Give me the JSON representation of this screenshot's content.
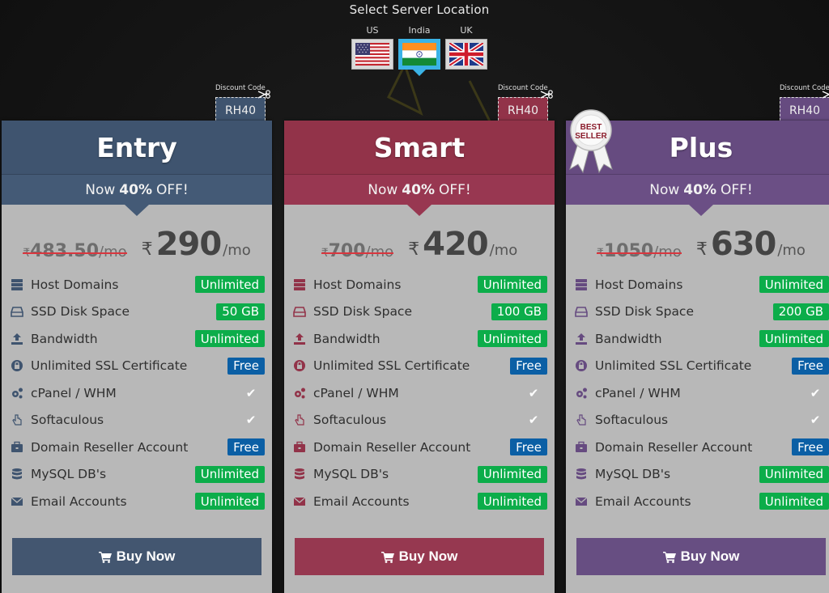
{
  "location_selector": {
    "title": "Select Server Location",
    "options": [
      {
        "label": "US",
        "flag": "us-flag",
        "active": false
      },
      {
        "label": "India",
        "flag": "india-flag",
        "active": true
      },
      {
        "label": "UK",
        "flag": "uk-flag",
        "active": false
      }
    ],
    "active_color": "#3bb3e6"
  },
  "discount": {
    "label": "Discount Code",
    "code": "RH40"
  },
  "best_seller_badge": {
    "line1": "BEST",
    "line2": "SELLER"
  },
  "currency_symbol": "₹",
  "per_period": "/mo",
  "plans": [
    {
      "name": "Entry",
      "offer_prefix": "Now",
      "offer_value": "40%",
      "offer_suffix": "OFF!",
      "old_price": "483.50",
      "new_price": "290",
      "color": "#3f546f",
      "buy_label": "Buy Now",
      "features": [
        {
          "icon": "server-icon",
          "name": "Host Domains",
          "value": "Unlimited",
          "type": "green"
        },
        {
          "icon": "hdd-icon",
          "name": "SSD Disk Space",
          "value": "50 GB",
          "type": "green"
        },
        {
          "icon": "upload-icon",
          "name": "Bandwidth",
          "value": "Unlimited",
          "type": "green"
        },
        {
          "icon": "lock-icon",
          "name": "Unlimited SSL Certificate",
          "value": "Free",
          "type": "blue"
        },
        {
          "icon": "gears-icon",
          "name": "cPanel / WHM",
          "value": "✔",
          "type": "check"
        },
        {
          "icon": "hand-pointer-icon",
          "name": "Softaculous",
          "value": "✔",
          "type": "check"
        },
        {
          "icon": "briefcase-icon",
          "name": "Domain Reseller Account",
          "value": "Free",
          "type": "blue"
        },
        {
          "icon": "database-icon",
          "name": "MySQL DB's",
          "value": "Unlimited",
          "type": "green"
        },
        {
          "icon": "envelope-icon",
          "name": "Email Accounts",
          "value": "Unlimited",
          "type": "green"
        }
      ]
    },
    {
      "name": "Smart",
      "offer_prefix": "Now",
      "offer_value": "40%",
      "offer_suffix": "OFF!",
      "old_price": "700",
      "new_price": "420",
      "color": "#923349",
      "buy_label": "Buy Now",
      "features": [
        {
          "icon": "server-icon",
          "name": "Host Domains",
          "value": "Unlimited",
          "type": "green"
        },
        {
          "icon": "hdd-icon",
          "name": "SSD Disk Space",
          "value": "100 GB",
          "type": "green"
        },
        {
          "icon": "upload-icon",
          "name": "Bandwidth",
          "value": "Unlimited",
          "type": "green"
        },
        {
          "icon": "lock-icon",
          "name": "Unlimited SSL Certificate",
          "value": "Free",
          "type": "blue"
        },
        {
          "icon": "gears-icon",
          "name": "cPanel / WHM",
          "value": "✔",
          "type": "check"
        },
        {
          "icon": "hand-pointer-icon",
          "name": "Softaculous",
          "value": "✔",
          "type": "check"
        },
        {
          "icon": "briefcase-icon",
          "name": "Domain Reseller Account",
          "value": "Free",
          "type": "blue"
        },
        {
          "icon": "database-icon",
          "name": "MySQL DB's",
          "value": "Unlimited",
          "type": "green"
        },
        {
          "icon": "envelope-icon",
          "name": "Email Accounts",
          "value": "Unlimited",
          "type": "green"
        }
      ]
    },
    {
      "name": "Plus",
      "offer_prefix": "Now",
      "offer_value": "40%",
      "offer_suffix": "OFF!",
      "old_price": "1050",
      "new_price": "630",
      "color": "#664b80",
      "best_seller": true,
      "buy_label": "Buy Now",
      "features": [
        {
          "icon": "server-icon",
          "name": "Host Domains",
          "value": "Unlimited",
          "type": "green"
        },
        {
          "icon": "hdd-icon",
          "name": "SSD Disk Space",
          "value": "200 GB",
          "type": "green"
        },
        {
          "icon": "upload-icon",
          "name": "Bandwidth",
          "value": "Unlimited",
          "type": "green"
        },
        {
          "icon": "lock-icon",
          "name": "Unlimited SSL Certificate",
          "value": "Free",
          "type": "blue"
        },
        {
          "icon": "gears-icon",
          "name": "cPanel / WHM",
          "value": "✔",
          "type": "check"
        },
        {
          "icon": "hand-pointer-icon",
          "name": "Softaculous",
          "value": "✔",
          "type": "check"
        },
        {
          "icon": "briefcase-icon",
          "name": "Domain Reseller Account",
          "value": "Free",
          "type": "blue"
        },
        {
          "icon": "database-icon",
          "name": "MySQL DB's",
          "value": "Unlimited",
          "type": "green"
        },
        {
          "icon": "envelope-icon",
          "name": "Email Accounts",
          "value": "Unlimited",
          "type": "green"
        }
      ]
    }
  ]
}
